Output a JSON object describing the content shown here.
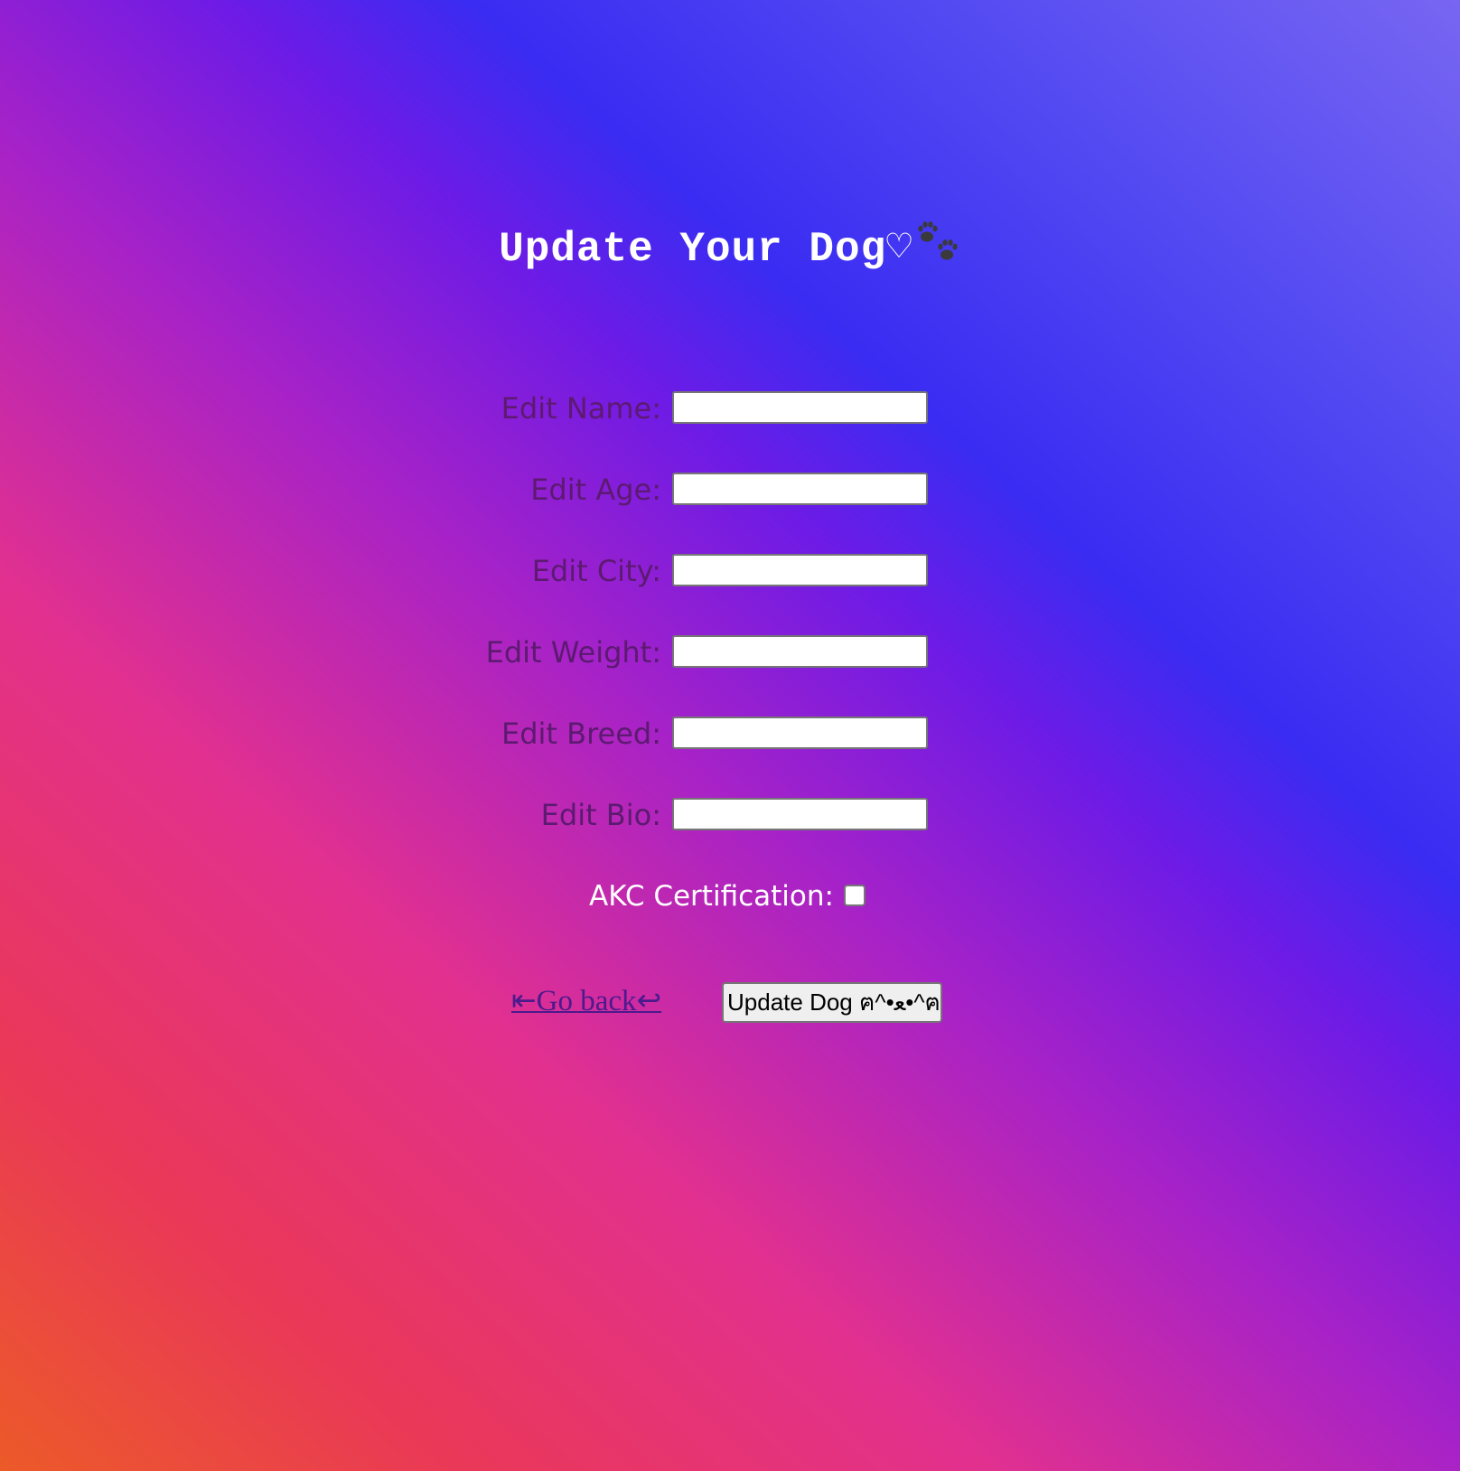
{
  "page": {
    "title": "Update Your Dog♡",
    "title_icon": "paws-icon"
  },
  "form": {
    "fields": [
      {
        "label": "Edit Name:",
        "value": "",
        "placeholder": ""
      },
      {
        "label": "Edit Age:",
        "value": "",
        "placeholder": ""
      },
      {
        "label": "Edit City:",
        "value": "",
        "placeholder": ""
      },
      {
        "label": "Edit Weight:",
        "value": "",
        "placeholder": ""
      },
      {
        "label": "Edit Breed:",
        "value": "",
        "placeholder": ""
      },
      {
        "label": "Edit Bio:",
        "value": "",
        "placeholder": ""
      }
    ],
    "akc": {
      "label": "AKC Certification:",
      "checked": false
    }
  },
  "actions": {
    "go_back_label": "⇤Go back↩",
    "submit_label": "Update Dog ฅ^•ﻌ•^ฅ"
  },
  "colors": {
    "label_color": "#5c1a70",
    "title_color": "#ffffff",
    "link_color": "#4b1a8c",
    "gradient": [
      "#ec5a28",
      "#e2308f",
      "#6d1be6",
      "#3a2cf2",
      "#7866f2"
    ]
  }
}
